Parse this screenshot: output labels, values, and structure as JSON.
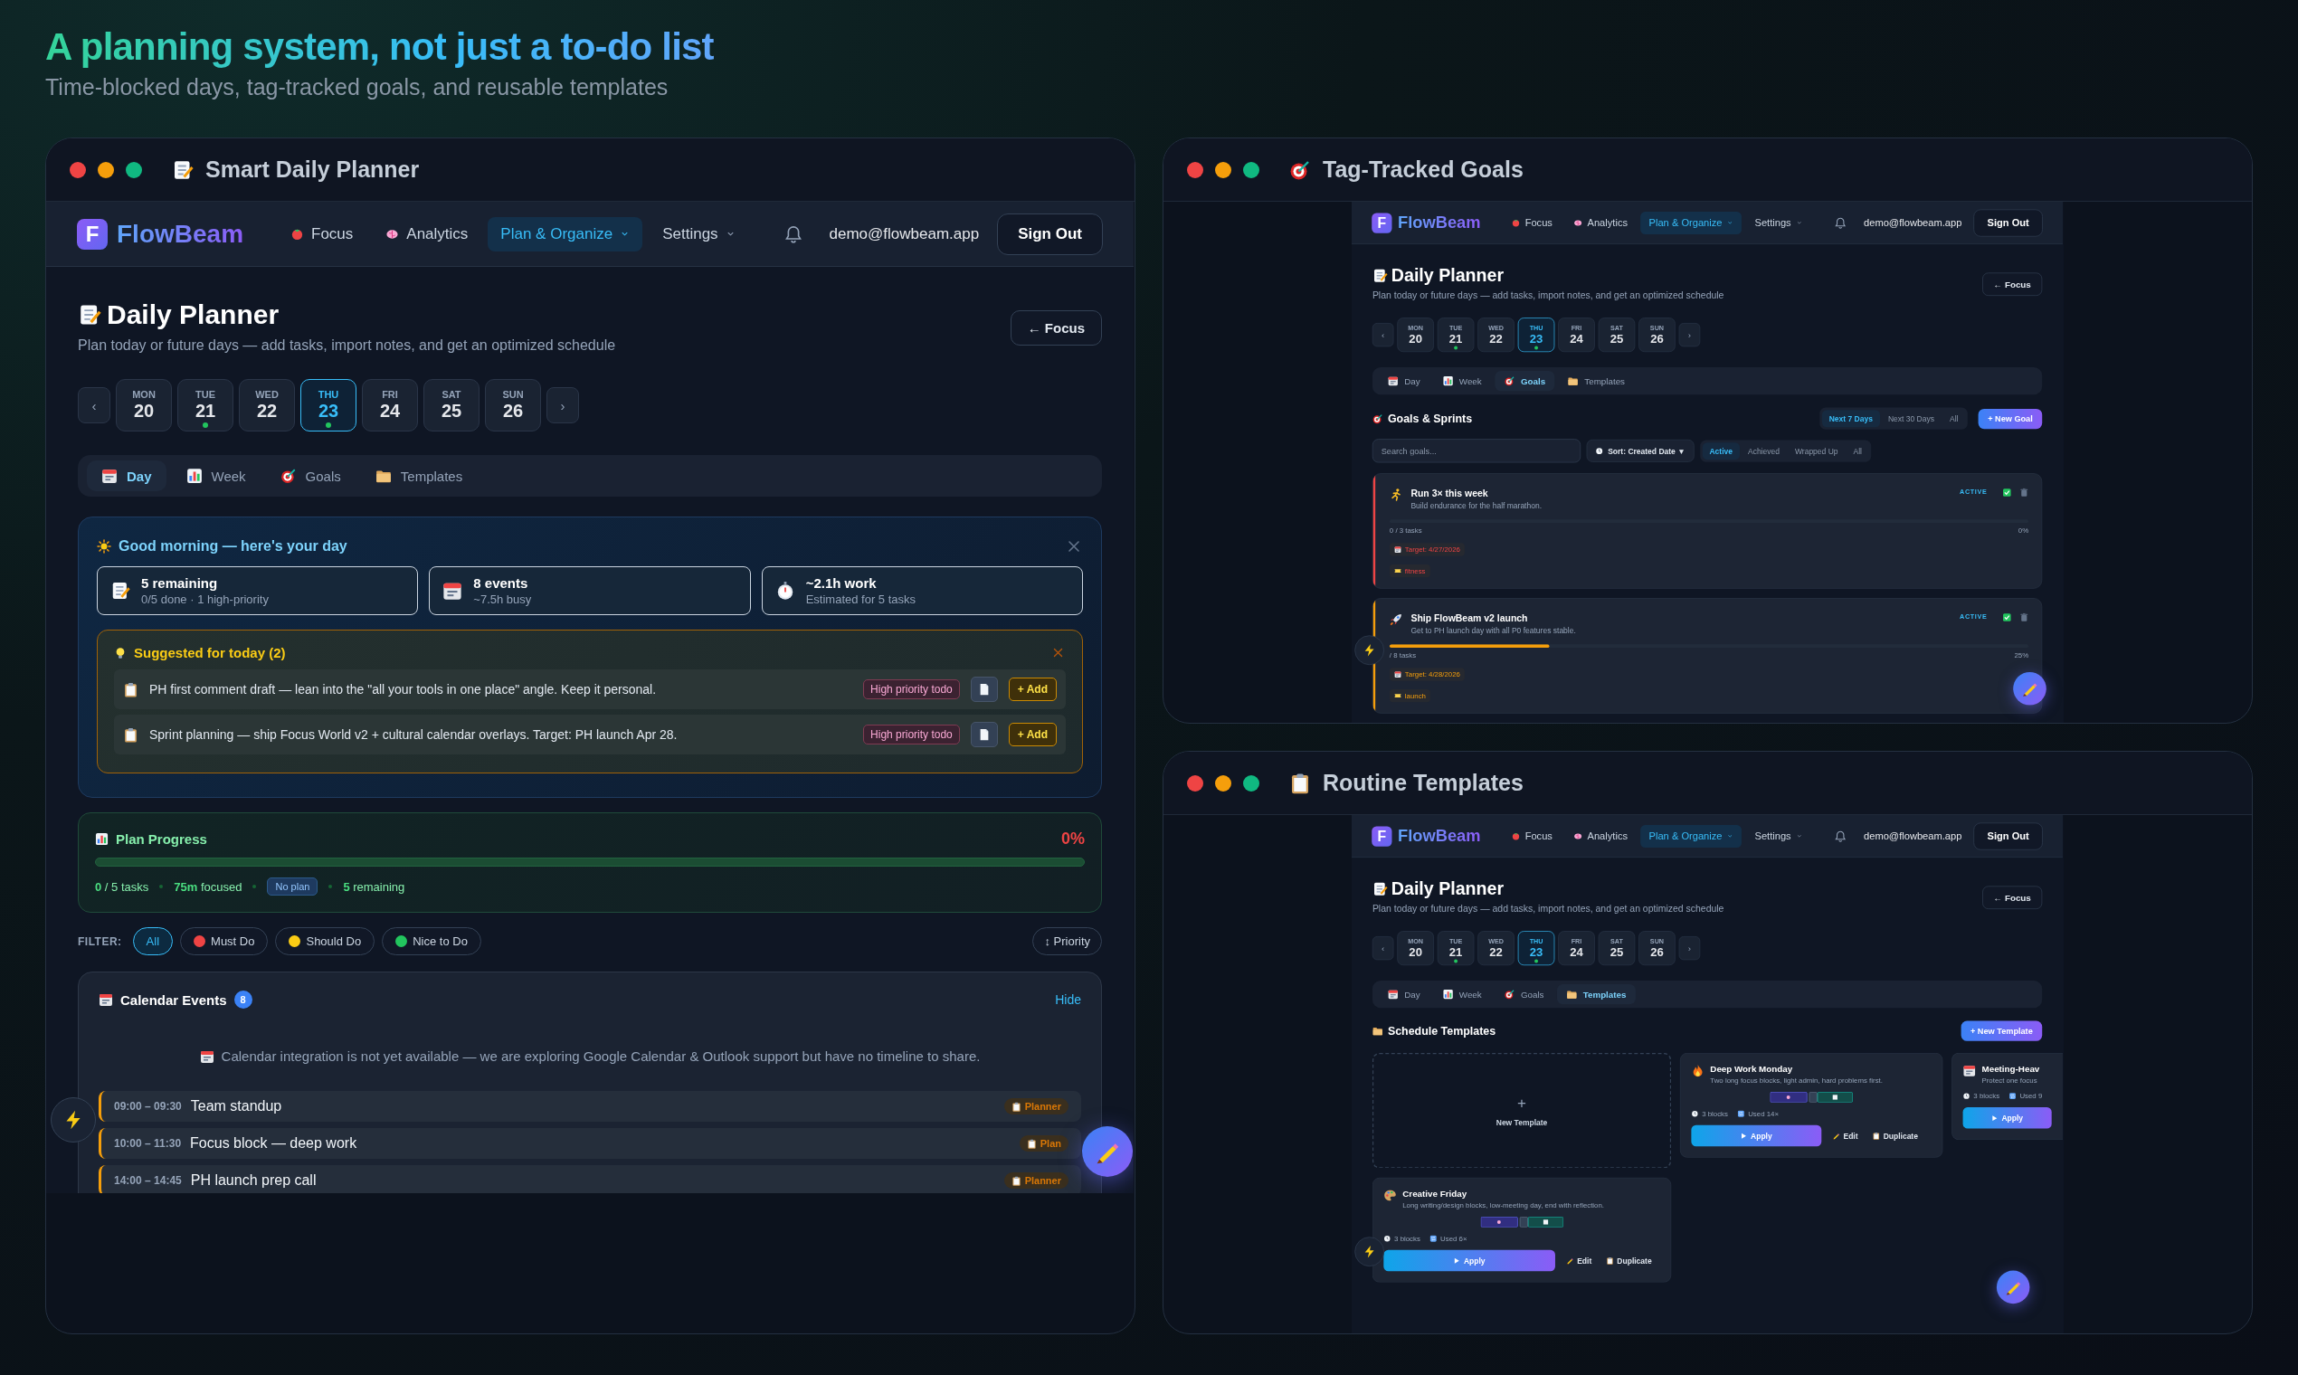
{
  "hero": {
    "title": "A planning system, not just a to-do list",
    "subtitle": "Time-blocked days, tag-tracked goals, and reusable templates"
  },
  "windows": [
    {
      "kind": "day",
      "title": "Smart Daily Planner",
      "app": {
        "logo": "F",
        "brand": "FlowBeam",
        "nav": [
          {
            "label": "Focus",
            "selected": false,
            "dropdown": false
          },
          {
            "label": "Analytics",
            "selected": false,
            "dropdown": false
          },
          {
            "label": "Plan & Organize",
            "selected": true,
            "dropdown": true
          },
          {
            "label": "Settings",
            "selected": false,
            "dropdown": true
          }
        ],
        "email": "demo@flowbeam.app",
        "sign_out": "Sign Out",
        "page_title": "Daily Planner",
        "page_subtitle": "Plan today or future days — add tasks, import notes, and get an optimized schedule",
        "back": "← Focus",
        "prev": "‹",
        "next": "›",
        "days": [
          {
            "weekday": "MON",
            "date": "20",
            "selected": false,
            "dot": false
          },
          {
            "weekday": "TUE",
            "date": "21",
            "selected": false,
            "dot": true
          },
          {
            "weekday": "WED",
            "date": "22",
            "selected": false,
            "dot": false
          },
          {
            "weekday": "THU",
            "date": "23",
            "selected": true,
            "dot": true
          },
          {
            "weekday": "FRI",
            "date": "24",
            "selected": false,
            "dot": false
          },
          {
            "weekday": "SAT",
            "date": "25",
            "selected": false,
            "dot": false
          },
          {
            "weekday": "SUN",
            "date": "26",
            "selected": false,
            "dot": false
          }
        ],
        "tabs": [
          {
            "label": "Day",
            "selected": true
          },
          {
            "label": "Week",
            "selected": false
          },
          {
            "label": "Goals",
            "selected": false
          },
          {
            "label": "Templates",
            "selected": false
          }
        ]
      },
      "day": {
        "briefing": {
          "title": "Good morning — here's your day",
          "stats": [
            {
              "value": "5 remaining",
              "detail": "0/5 done · 1 high-priority"
            },
            {
              "value": "8 events",
              "detail": "~7.5h busy"
            },
            {
              "value": "~2.1h work",
              "detail": "Estimated for 5 tasks"
            }
          ],
          "suggestions": {
            "title": "Suggested for today (2)",
            "items": [
              {
                "text": "PH first comment draft — lean into the \"all your tools in one place\" angle. Keep it personal.",
                "tag": "High priority todo",
                "add": "+ Add"
              },
              {
                "text": "Sprint planning — ship Focus World v2 + cultural calendar overlays. Target: PH launch Apr 28.",
                "tag": "High priority todo",
                "add": "+ Add"
              }
            ]
          }
        },
        "progress": {
          "title": "Plan Progress",
          "percent": "0%",
          "level": 0,
          "tasks": "**0** / 5 tasks",
          "focused": "**75m** focused",
          "plan": "No plan",
          "remaining": "**5** remaining"
        },
        "filter": {
          "label": "FILTER:",
          "options": [
            {
              "label": "All",
              "selected": true
            },
            {
              "label": "Must Do",
              "selected": false,
              "color": "#ef4444"
            },
            {
              "label": "Should Do",
              "selected": false,
              "color": "#facc15"
            },
            {
              "label": "Nice to Do",
              "selected": false,
              "color": "#22c55e"
            }
          ],
          "sort": "↕ Priority"
        },
        "calendar": {
          "title": "Calendar Events",
          "count": "8",
          "hide": "Hide",
          "notice": "Calendar integration is not yet available — we are exploring Google Calendar & Outlook support but have no timeline to share.",
          "events": [
            {
              "time": "09:00 – 09:30",
              "title": "Team standup",
              "source": "Planner"
            },
            {
              "time": "10:00 – 11:30",
              "title": "Focus block — deep work",
              "source": "Plan"
            },
            {
              "time": "14:00 – 14:45",
              "title": "PH launch prep call",
              "source": "Planner"
            }
          ]
        }
      }
    },
    {
      "kind": "goals",
      "title": "Tag-Tracked Goals",
      "app": {
        "logo": "F",
        "brand": "FlowBeam",
        "nav": [
          {
            "label": "Focus",
            "selected": false,
            "dropdown": false
          },
          {
            "label": "Analytics",
            "selected": false,
            "dropdown": false
          },
          {
            "label": "Plan & Organize",
            "selected": true,
            "dropdown": true
          },
          {
            "label": "Settings",
            "selected": false,
            "dropdown": true
          }
        ],
        "email": "demo@flowbeam.app",
        "sign_out": "Sign Out",
        "page_title": "Daily Planner",
        "page_subtitle": "Plan today or future days — add tasks, import notes, and get an optimized schedule",
        "back": "← Focus",
        "prev": "‹",
        "next": "›",
        "days": [
          {
            "weekday": "MON",
            "date": "20",
            "selected": false,
            "dot": false
          },
          {
            "weekday": "TUE",
            "date": "21",
            "selected": false,
            "dot": true
          },
          {
            "weekday": "WED",
            "date": "22",
            "selected": false,
            "dot": false
          },
          {
            "weekday": "THU",
            "date": "23",
            "selected": true,
            "dot": true
          },
          {
            "weekday": "FRI",
            "date": "24",
            "selected": false,
            "dot": false
          },
          {
            "weekday": "SAT",
            "date": "25",
            "selected": false,
            "dot": false
          },
          {
            "weekday": "SUN",
            "date": "26",
            "selected": false,
            "dot": false
          }
        ],
        "tabs": [
          {
            "label": "Day",
            "selected": false
          },
          {
            "label": "Week",
            "selected": false
          },
          {
            "label": "Goals",
            "selected": true
          },
          {
            "label": "Templates",
            "selected": false
          }
        ]
      },
      "goals": {
        "title": "Goals & Sprints",
        "ranges": [
          {
            "label": "Next 7 Days",
            "selected": true
          },
          {
            "label": "Next 30 Days",
            "selected": false
          },
          {
            "label": "All",
            "selected": false
          }
        ],
        "new_goal": "+ New Goal",
        "search_placeholder": "Search goals...",
        "sort": "Sort: Created Date",
        "sort_caret": "▼",
        "statuses": [
          {
            "label": "Active",
            "selected": true
          },
          {
            "label": "Achieved",
            "selected": false
          },
          {
            "label": "Wrapped Up",
            "selected": false
          },
          {
            "label": "All",
            "selected": false
          }
        ],
        "items": [
          {
            "title": "Run 3× this week",
            "description": "Build endurance for the half marathon.",
            "status": "ACTIVE",
            "tasks": "0 / 3 tasks",
            "percent": "0%",
            "level": 0,
            "target": "Target: 4/27/2026",
            "tag": "fitness",
            "color": "#ef4444"
          },
          {
            "title": "Ship FlowBeam v2 launch",
            "description": "Get to PH launch day with all P0 features stable.",
            "status": "ACTIVE",
            "tasks": "/ 8 tasks",
            "percent": "25%",
            "level": 0.25,
            "target": "Target: 4/28/2026",
            "tag": "launch",
            "color": "#f59e0b"
          }
        ]
      }
    },
    {
      "kind": "templates",
      "title": "Routine Templates",
      "app": {
        "logo": "F",
        "brand": "FlowBeam",
        "nav": [
          {
            "label": "Focus",
            "selected": false,
            "dropdown": false
          },
          {
            "label": "Analytics",
            "selected": false,
            "dropdown": false
          },
          {
            "label": "Plan & Organize",
            "selected": true,
            "dropdown": true
          },
          {
            "label": "Settings",
            "selected": false,
            "dropdown": true
          }
        ],
        "email": "demo@flowbeam.app",
        "sign_out": "Sign Out",
        "page_title": "Daily Planner",
        "page_subtitle": "Plan today or future days — add tasks, import notes, and get an optimized schedule",
        "back": "← Focus",
        "prev": "‹",
        "next": "›",
        "days": [
          {
            "weekday": "MON",
            "date": "20",
            "selected": false,
            "dot": false
          },
          {
            "weekday": "TUE",
            "date": "21",
            "selected": false,
            "dot": true
          },
          {
            "weekday": "WED",
            "date": "22",
            "selected": false,
            "dot": false
          },
          {
            "weekday": "THU",
            "date": "23",
            "selected": true,
            "dot": true
          },
          {
            "weekday": "FRI",
            "date": "24",
            "selected": false,
            "dot": false
          },
          {
            "weekday": "SAT",
            "date": "25",
            "selected": false,
            "dot": false
          },
          {
            "weekday": "SUN",
            "date": "26",
            "selected": false,
            "dot": false
          }
        ],
        "tabs": [
          {
            "label": "Day",
            "selected": false
          },
          {
            "label": "Week",
            "selected": false
          },
          {
            "label": "Goals",
            "selected": false
          },
          {
            "label": "Templates",
            "selected": true
          }
        ]
      },
      "templates": {
        "title": "Schedule Templates",
        "new_template": "+ New Template",
        "new_card": {
          "plus": "+",
          "label": "New Template"
        },
        "items": [
          {
            "title": "Deep Work Monday",
            "description": "Two long focus blocks, light admin, hard problems first.",
            "blocks": "3 blocks",
            "used": "Used 14×",
            "apply": "Apply",
            "edit": "Edit",
            "duplicate": "Duplicate"
          },
          {
            "title": "Meeting-Heav",
            "description": "Protect one focus",
            "blocks": "3 blocks",
            "used": "Used 9",
            "apply": "Apply"
          },
          {
            "title": "Creative Friday",
            "description": "Long writing/design blocks, low-meeting day, end with reflection.",
            "blocks": "3 blocks",
            "used": "Used 6×",
            "apply": "Apply",
            "edit": "Edit",
            "duplicate": "Duplicate"
          }
        ]
      }
    }
  ]
}
